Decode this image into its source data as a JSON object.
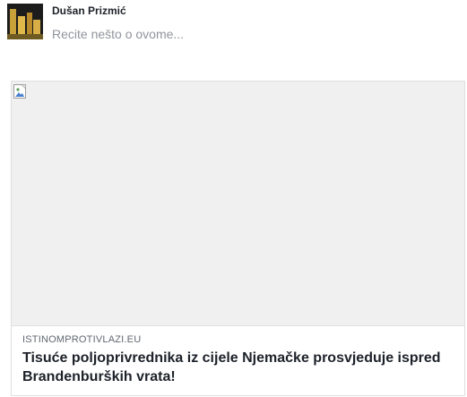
{
  "post": {
    "author_name": "Dušan Prizmić",
    "composer_placeholder": "Recite nešto o ovome..."
  },
  "link_preview": {
    "image_icon": "broken-image-icon",
    "domain": "ISTINOMPROTIVLAZI.EU",
    "title": "Tisuće poljoprivrednika iz cijele Njemačke prosvjeduje ispred Brandenburških vrata!"
  },
  "colors": {
    "author": "#1d2129",
    "placeholder": "#90949c",
    "domain": "#606770",
    "card_border": "#dddfe2",
    "image_bg": "#f0f0f0"
  }
}
